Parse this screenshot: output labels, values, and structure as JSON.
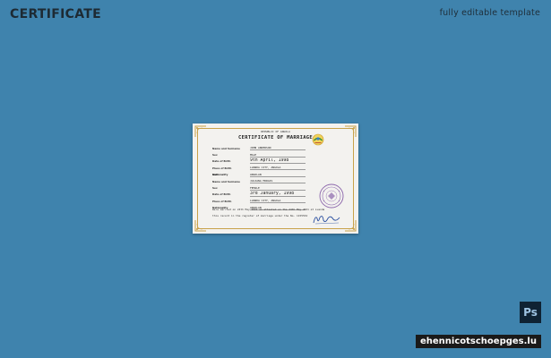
{
  "header": {
    "title": "CERTIFICATE",
    "subtitle": "fully editable template"
  },
  "certificate": {
    "country": "REPUBLIC OF ANGOLA",
    "heading": "CERTIFICATE OF MARRIAGE",
    "emblem_icon": "angola-emblem-icon",
    "party_one": [
      {
        "label": "Name and Surname",
        "value": "JOHN ANDERSON"
      },
      {
        "label": "Sex",
        "value": "MALE"
      },
      {
        "label": "Date of Birth",
        "value": "9th April, 1998"
      },
      {
        "label": "Place of Birth",
        "value": "LUANDA CITY, ANGOLA"
      },
      {
        "label": "Nationality",
        "value": "ANGOLAN"
      }
    ],
    "and_label": "and",
    "party_two": [
      {
        "label": "Name and Surname",
        "value": "JULIANA MORAIS"
      },
      {
        "label": "Sex",
        "value": "FEMALE"
      },
      {
        "label": "Date of Birth",
        "value": "3rd January, 1998"
      },
      {
        "label": "Place of Birth",
        "value": "LUANDA CITY, ANGOLA"
      },
      {
        "label": "Nationality",
        "value": "ANGOLAN"
      }
    ],
    "statement_line1": "Were married on 24th May 2021 as attested on the 24th May 2021 at Luanda",
    "statement_line2": "this record in the register of marriage under the No. 1155534",
    "stamp_icon": "official-seal-icon",
    "signature_icon": "signature-icon"
  },
  "badges": {
    "ps_label": "Ps",
    "watermark": "ehennicotschoepges.lu"
  },
  "colors": {
    "background": "#3f83ad",
    "paper": "#f3f2ef",
    "gold": "#c8a24a",
    "stamp": "#7a4fa0",
    "signature": "#2a4fa0"
  }
}
